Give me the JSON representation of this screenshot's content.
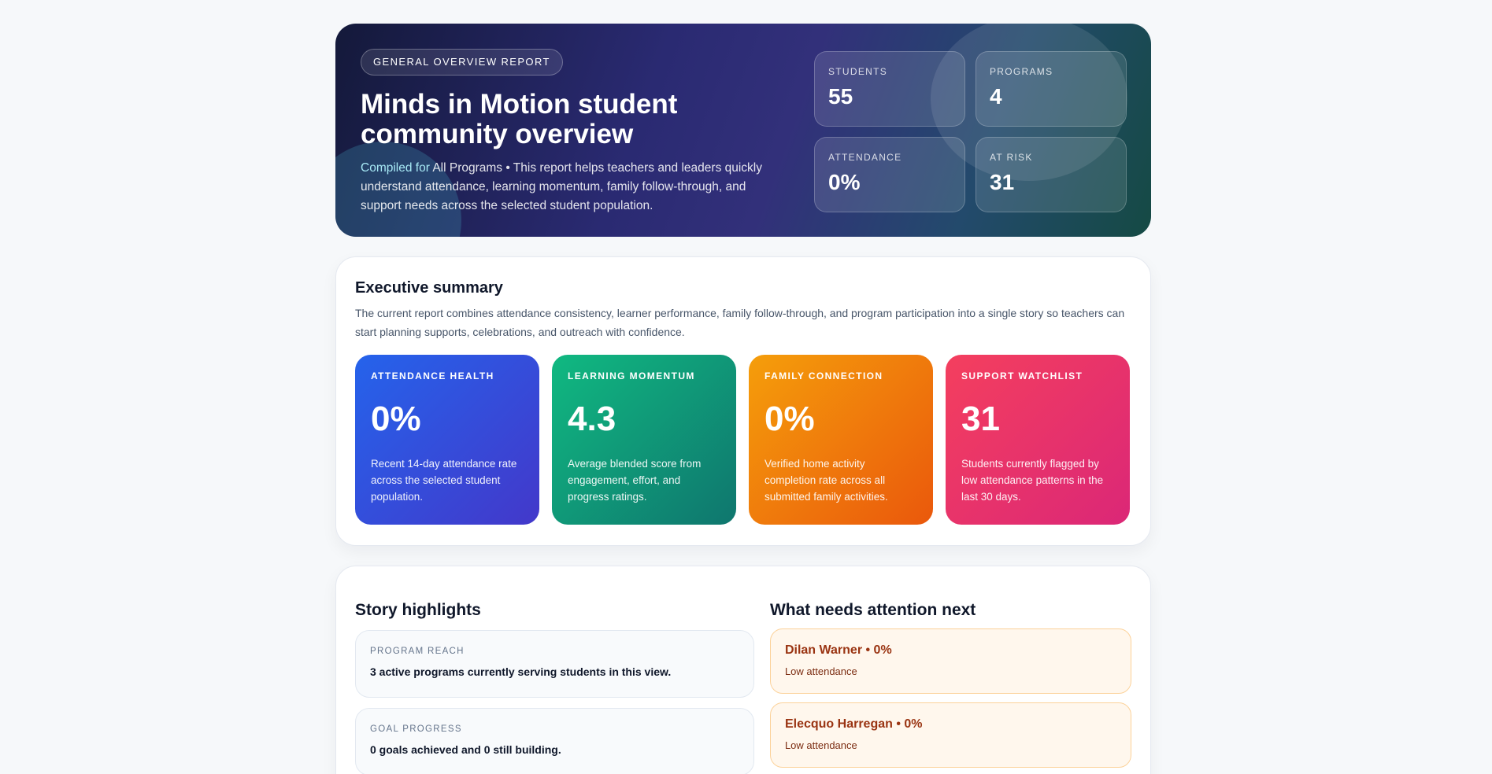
{
  "hero": {
    "tag": "General overview report",
    "title": "Minds in Motion student community overview",
    "lead": "Compiled for",
    "program": "All Programs",
    "description": "• This report helps teachers and leaders quickly understand attendance, learning momentum, family follow-through, and support needs across the selected student population.",
    "stats": [
      {
        "label": "Students",
        "value": "55"
      },
      {
        "label": "Programs",
        "value": "4"
      },
      {
        "label": "Attendance",
        "value": "0%"
      },
      {
        "label": "At risk",
        "value": "31"
      }
    ]
  },
  "executive": {
    "title": "Executive summary",
    "description": "The current report combines attendance consistency, learner performance, family follow-through, and program participation into a single story so teachers can start planning supports, celebrations, and outreach with confidence.",
    "metrics": [
      {
        "label": "Attendance health",
        "value": "0%",
        "desc": "Recent 14-day attendance rate across the selected student population.",
        "color": "#2563eb"
      },
      {
        "label": "Learning momentum",
        "value": "4.3",
        "desc": "Average blended score from engagement, effort, and progress ratings.",
        "color": "#10b981"
      },
      {
        "label": "Family connection",
        "value": "0%",
        "desc": "Verified home activity completion rate across all submitted family activities.",
        "color": "#f59e0b"
      },
      {
        "label": "Support watchlist",
        "value": "31",
        "desc": "Students currently flagged by low attendance patterns in the last 30 days.",
        "color": "#f43f5e"
      }
    ]
  },
  "highlights": {
    "title": "Story highlights",
    "items": [
      {
        "label": "Program reach",
        "text": "3 active programs currently serving students in this view."
      },
      {
        "label": "Goal progress",
        "text": "0 goals achieved and 0 still building."
      }
    ]
  },
  "attention": {
    "title": "What needs attention next",
    "items": [
      {
        "name": "Dilan Warner • 0%",
        "reason": "Low attendance"
      },
      {
        "name": "Elecquo Harregan • 0%",
        "reason": "Low attendance"
      }
    ]
  }
}
